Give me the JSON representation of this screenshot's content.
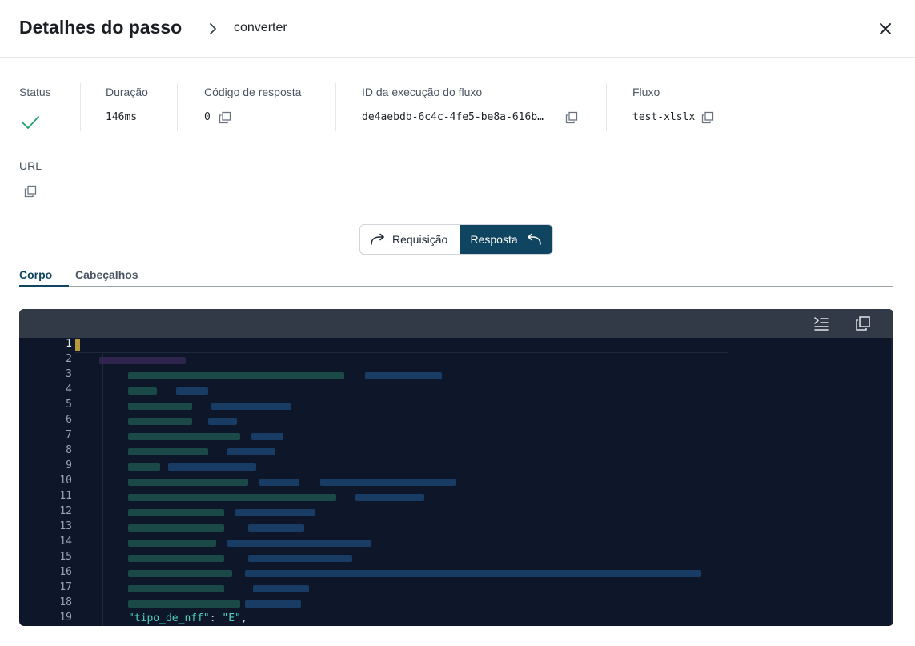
{
  "header": {
    "title": "Detalhes do passo",
    "breadcrumb": "converter"
  },
  "meta": {
    "status_label": "Status",
    "duration_label": "Duração",
    "duration_value": "146ms",
    "response_code_label": "Código de resposta",
    "response_code_value": "0",
    "execution_id_label": "ID da execução do fluxo",
    "execution_id_value": "de4aebdb-6c4c-4fe5-be8a-616b…",
    "flow_label": "Fluxo",
    "flow_value": "test-xlslx",
    "url_label": "URL"
  },
  "toggle": {
    "request_label": "Requisição",
    "response_label": "Resposta",
    "active": "Resposta"
  },
  "tabs": {
    "body_label": "Corpo",
    "headers_label": "Cabeçalhos",
    "active": "Corpo"
  },
  "editor": {
    "line_numbers": [
      "1",
      "2",
      "3",
      "4",
      "5",
      "6",
      "7",
      "8",
      "9",
      "10",
      "11",
      "12",
      "13",
      "14",
      "15",
      "16",
      "17",
      "18",
      "19"
    ],
    "current_line": "1",
    "visible_line": {
      "key": "\"tipo_de_nff\"",
      "separator": ": ",
      "value": "\"E\"",
      "trail": ","
    }
  },
  "icons": {
    "close": "close-icon",
    "chevron": "chevron-right-icon",
    "check": "check-icon",
    "copy": "copy-icon",
    "wrap": "wrap-lines-icon",
    "redo": "arrow-redo-icon",
    "undo": "arrow-undo-icon"
  },
  "colors": {
    "accent": "#0f4560",
    "success": "#22a06b",
    "editor_bg": "#0e1729",
    "editor_bar": "#333a47"
  }
}
